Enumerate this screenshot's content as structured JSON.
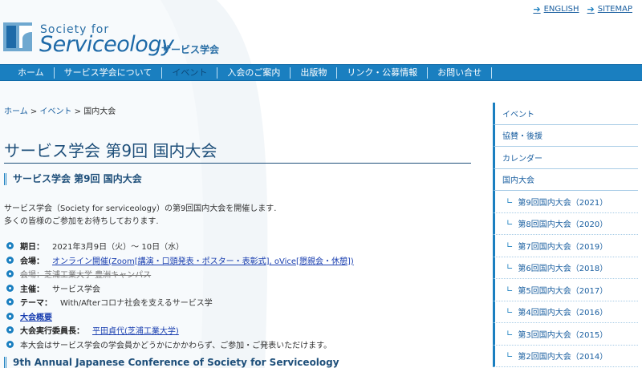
{
  "header": {
    "logo_small": "Society for",
    "logo_big": "Serviceology",
    "logo_jp": "サービス学会",
    "links": [
      {
        "label": "ENGLISH"
      },
      {
        "label": "SITEMAP"
      }
    ]
  },
  "nav": {
    "items": [
      {
        "label": "ホーム",
        "active": false
      },
      {
        "label": "サービス学会について",
        "active": false
      },
      {
        "label": "イベント",
        "active": true
      },
      {
        "label": "入会のご案内",
        "active": false
      },
      {
        "label": "出版物",
        "active": false
      },
      {
        "label": "リンク・公募情報",
        "active": false
      },
      {
        "label": "お問い合せ",
        "active": false
      }
    ]
  },
  "breadcrumb": {
    "home": "ホーム",
    "sep1": " > ",
    "event": "イベント",
    "sep2": " > ",
    "current": "国内大会"
  },
  "main": {
    "title": "サービス学会 第9回 国内大会",
    "section_heading": "サービス学会 第9回 国内大会",
    "intro_line1": "サービス学会（Society for serviceology）の第9回国内大会を開催します.",
    "intro_line2": "多くの皆様のご参加をお待ちしております.",
    "details": {
      "date_label": "期日：",
      "date_value": "2021年3月9日（火）～ 10日（水）",
      "venue_label": "会場：",
      "venue_link": "オンライン開催(Zoom[講演・口頭発表・ポスター・表彰式], oVice[懇親会・休憩])",
      "old_venue": "会場：芝浦工業大学 豊洲キャンパス",
      "host_label": "主催：",
      "host_value": "サービス学会",
      "theme_label": "テーマ：",
      "theme_value": "With/Afterコロナ社会を支えるサービス学",
      "overview_link": "大会概要",
      "chair_label": "大会実行委員長：",
      "chair_link": "平田貞代(芝浦工業大学)",
      "note": "本大会はサービス学会の学会員かどうかにかかわらず、ご参加・ご発表いただけます。"
    },
    "english_heading": "9th Annual Japanese Conference of Society for Serviceology"
  },
  "sidebar": {
    "items": [
      {
        "label": "イベント"
      },
      {
        "label": "協賛・後援"
      },
      {
        "label": "カレンダー"
      },
      {
        "label": "国内大会"
      }
    ],
    "subitems": [
      {
        "label": "第9回国内大会（2021）"
      },
      {
        "label": "第8回国内大会（2020）"
      },
      {
        "label": "第7回国内大会（2019）"
      },
      {
        "label": "第6回国内大会（2018）"
      },
      {
        "label": "第5回国内大会（2017）"
      },
      {
        "label": "第4回国内大会（2016）"
      },
      {
        "label": "第3回国内大会（2015）"
      },
      {
        "label": "第2回国内大会（2014）"
      }
    ],
    "corner_glyph": "∟"
  },
  "colors": {
    "nav_bg": "#1a7fc0",
    "heading": "#1e4f7a",
    "link": "#1a5fa0"
  }
}
